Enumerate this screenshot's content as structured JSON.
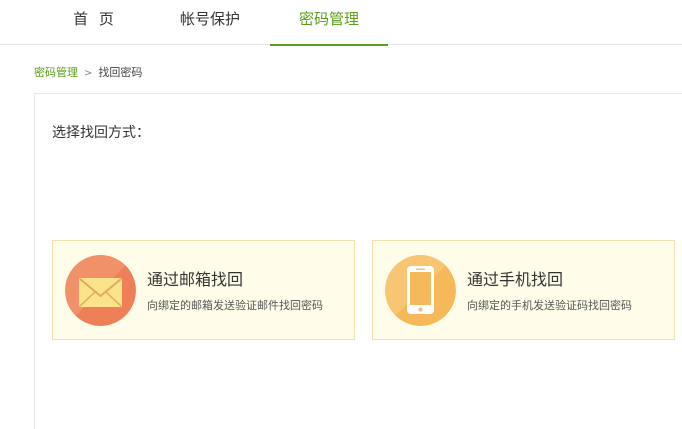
{
  "nav": {
    "tabs": [
      {
        "label": "首 页"
      },
      {
        "label": "帐号保护"
      },
      {
        "label": "密码管理"
      }
    ],
    "active_tab": "密码管理",
    "accent_color": "#5a9e1a"
  },
  "breadcrumb": {
    "parent": "密码管理",
    "separator": ">",
    "current": "找回密码"
  },
  "main": {
    "prompt": "选择找回方式：",
    "options": [
      {
        "title": "通过邮箱找回",
        "desc": "向绑定的邮箱发送验证邮件找回密码",
        "icon": "envelope-icon",
        "color": "#ee7f56"
      },
      {
        "title": "通过手机找回",
        "desc": "向绑定的手机发送验证码找回密码",
        "icon": "mobile-phone-icon",
        "color": "#f6b95a"
      }
    ]
  }
}
